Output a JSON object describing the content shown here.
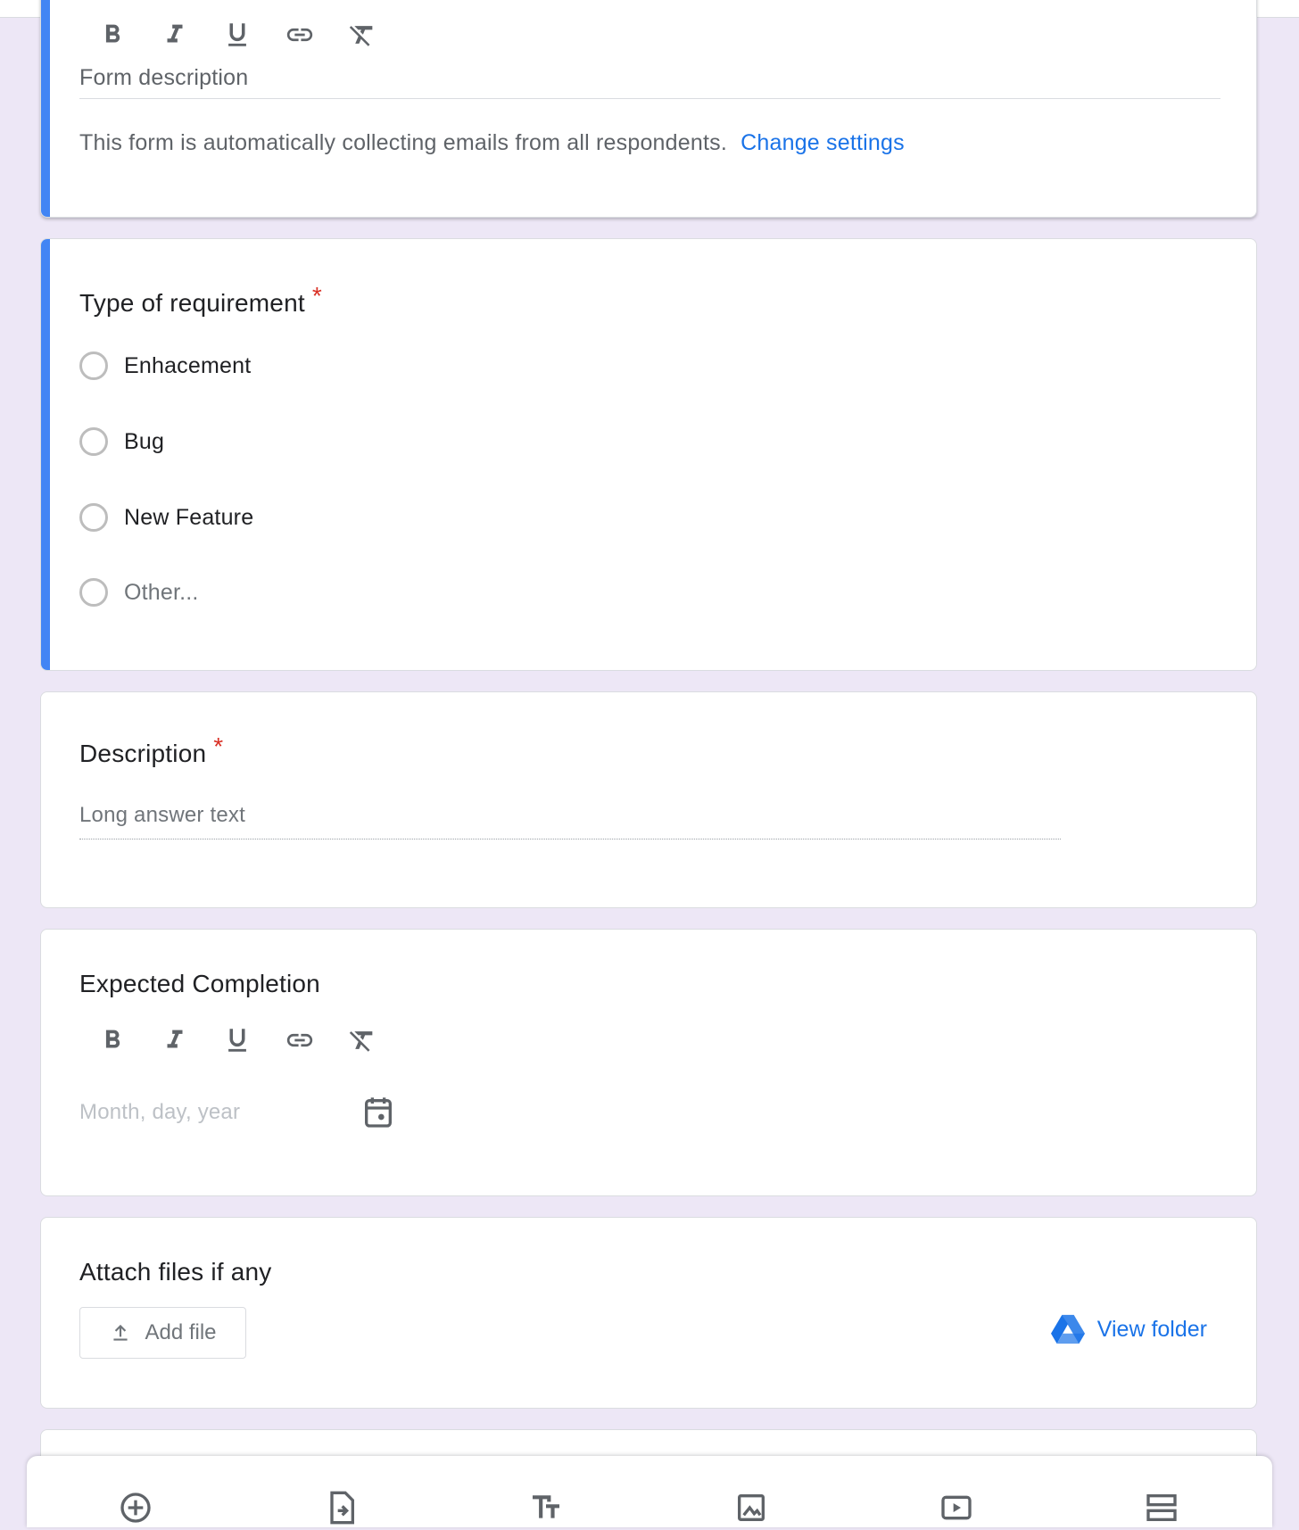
{
  "header_card": {
    "toolbar": [
      "bold",
      "italic",
      "underline",
      "link",
      "clear-formatting"
    ],
    "form_description_placeholder": "Form description",
    "email_note": "This form is automatically collecting emails from all respondents.",
    "change_settings_label": "Change settings"
  },
  "questions": [
    {
      "title": "Type of requirement",
      "required_mark": "*",
      "options": [
        "Enhacement",
        "Bug",
        "New Feature",
        "Other..."
      ]
    },
    {
      "title": "Description",
      "required_mark": "*",
      "answer_placeholder": "Long answer text"
    },
    {
      "title": "Expected Completion",
      "date_placeholder": "Month, day, year"
    },
    {
      "title": "Attach files if any",
      "add_file_label": "Add file",
      "view_folder_label": "View folder"
    }
  ],
  "colors": {
    "background": "#ede7f6",
    "accent_bar": "#4285f4",
    "link": "#1a73e8",
    "required": "#d93025",
    "tab_indicator": "#673ab7"
  },
  "bottom_bar_icons": [
    "add-question-icon",
    "import-questions-icon",
    "add-title-icon",
    "add-image-icon",
    "add-video-icon",
    "add-section-icon"
  ]
}
